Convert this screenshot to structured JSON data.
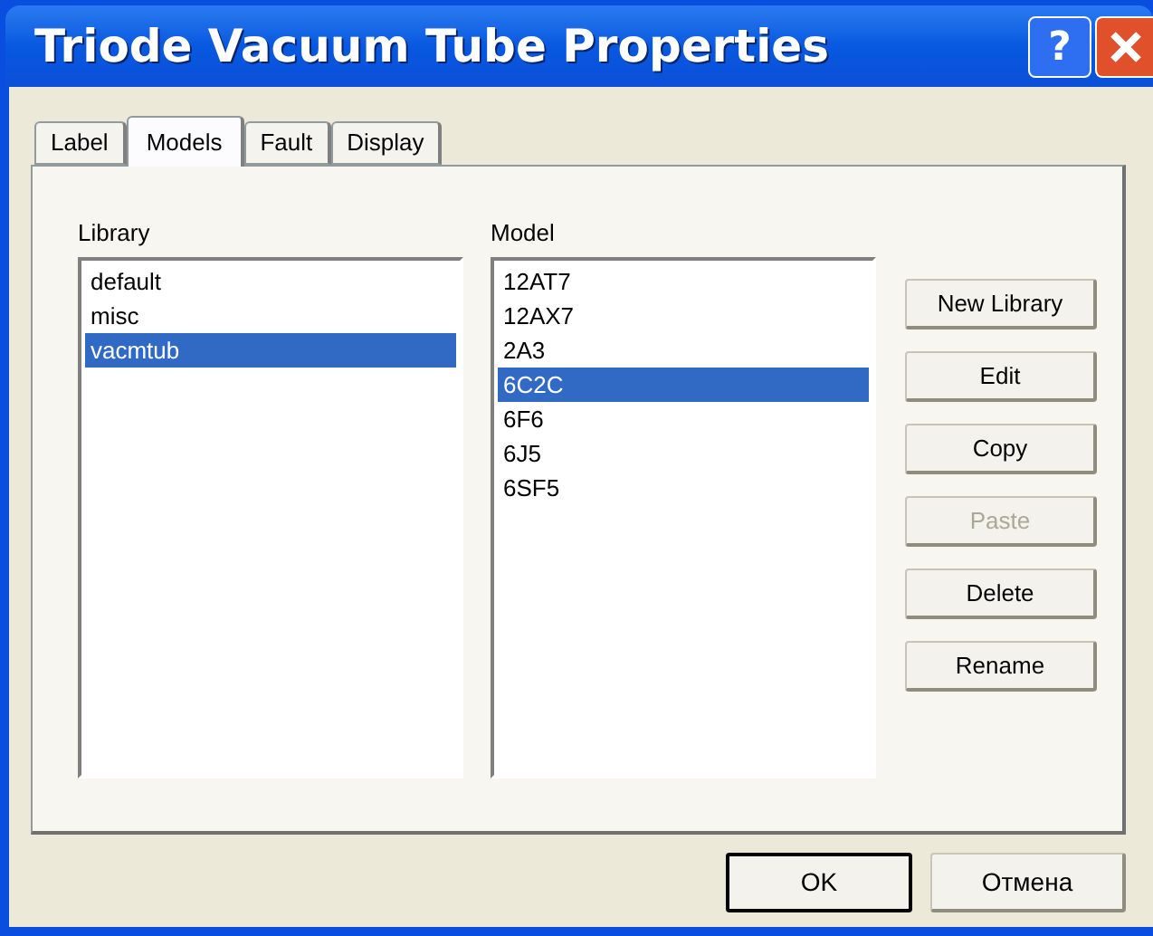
{
  "window": {
    "title": "Triode Vacuum Tube Properties",
    "help_button": "?"
  },
  "tabs": [
    {
      "label": "Label",
      "selected": false
    },
    {
      "label": "Models",
      "selected": true
    },
    {
      "label": "Fault",
      "selected": false
    },
    {
      "label": "Display",
      "selected": false
    }
  ],
  "library": {
    "label": "Library",
    "items": [
      {
        "label": "default",
        "selected": false
      },
      {
        "label": "misc",
        "selected": false
      },
      {
        "label": "vacmtub",
        "selected": true
      }
    ]
  },
  "model": {
    "label": "Model",
    "items": [
      {
        "label": "12AT7",
        "selected": false
      },
      {
        "label": "12AX7",
        "selected": false
      },
      {
        "label": "2A3",
        "selected": false
      },
      {
        "label": "6C2C",
        "selected": true
      },
      {
        "label": "6F6",
        "selected": false
      },
      {
        "label": "6J5",
        "selected": false
      },
      {
        "label": "6SF5",
        "selected": false
      }
    ]
  },
  "side_buttons": [
    {
      "label": "New Library",
      "disabled": false
    },
    {
      "label": "Edit",
      "disabled": false
    },
    {
      "label": "Copy",
      "disabled": false
    },
    {
      "label": "Paste",
      "disabled": true
    },
    {
      "label": "Delete",
      "disabled": false
    },
    {
      "label": "Rename",
      "disabled": false
    }
  ],
  "footer_buttons": [
    {
      "label": "OK",
      "default": true
    },
    {
      "label": "Отмена",
      "default": false
    }
  ]
}
